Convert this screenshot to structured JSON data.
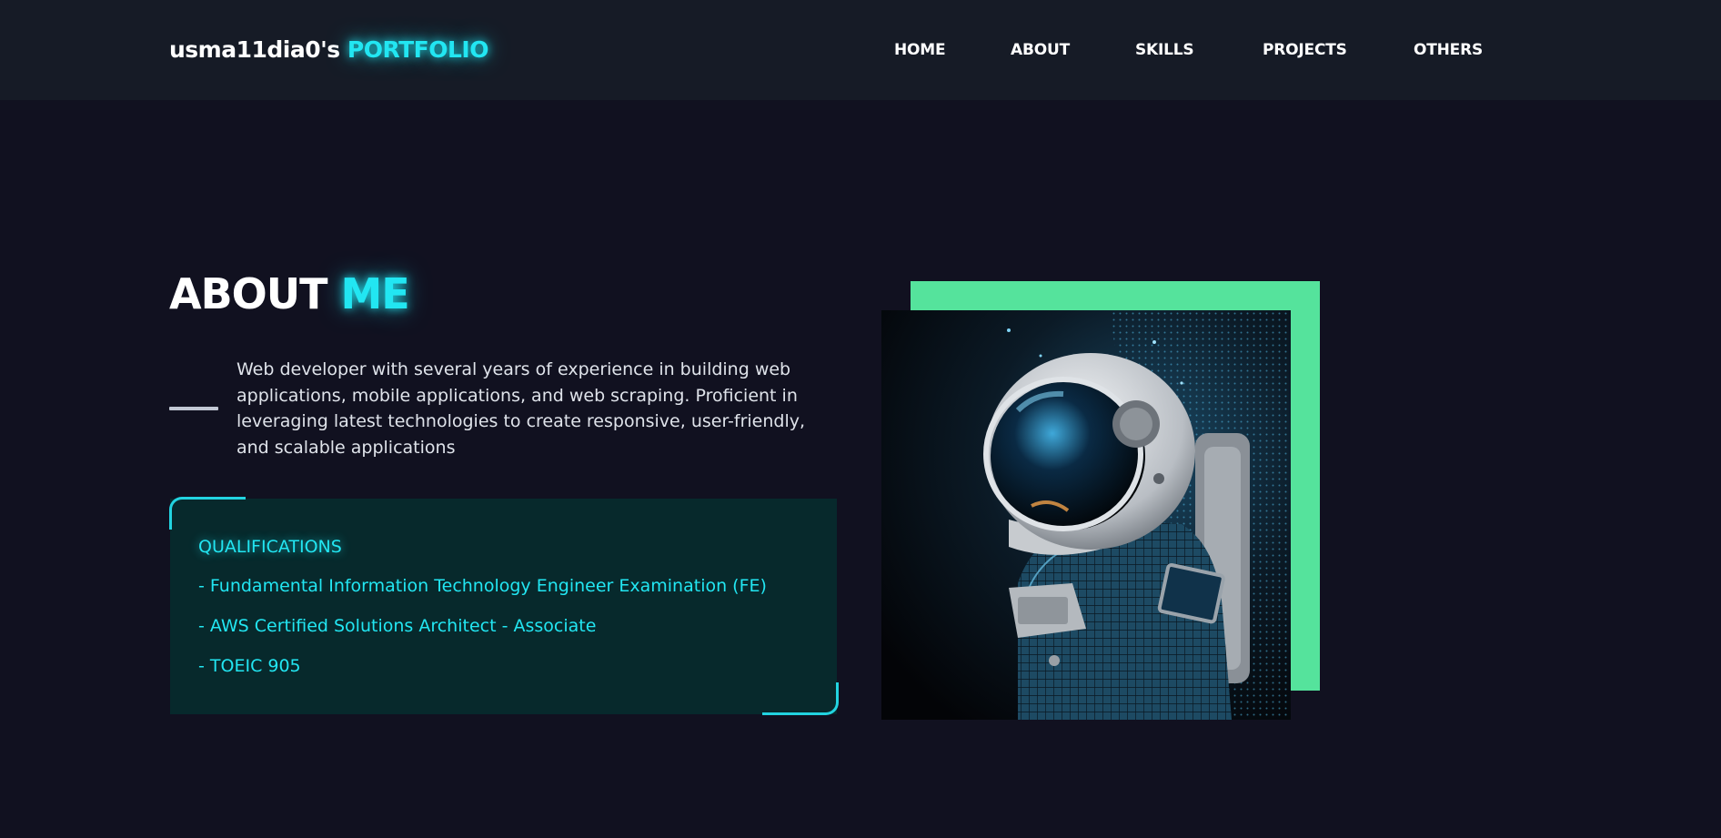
{
  "header": {
    "logo_prefix": "usma11dia0's",
    "logo_accent": "PORTFOLIO",
    "nav": [
      "HOME",
      "ABOUT",
      "SKILLS",
      "PROJECTS",
      "OTHERS"
    ]
  },
  "about": {
    "title_main": "ABOUT",
    "title_accent": "ME",
    "bio": "Web developer with several years of experience in building web applications, mobile applications, and web scraping. Proficient in leveraging latest technologies to create responsive, user-friendly, and scalable applications"
  },
  "qualifications": {
    "title": "QUALIFICATIONS",
    "items": [
      "- Fundamental Information Technology Engineer Examination (FE)",
      "- AWS Certified Solutions Architect - Associate",
      "- TOEIC 905"
    ]
  },
  "image": {
    "icon": "astronaut-illustration"
  },
  "colors": {
    "background": "#111120",
    "navbar": "#161b26",
    "accent": "#22e6f2",
    "qual_box": "#07292c",
    "photo_frame": "#55e39c"
  }
}
